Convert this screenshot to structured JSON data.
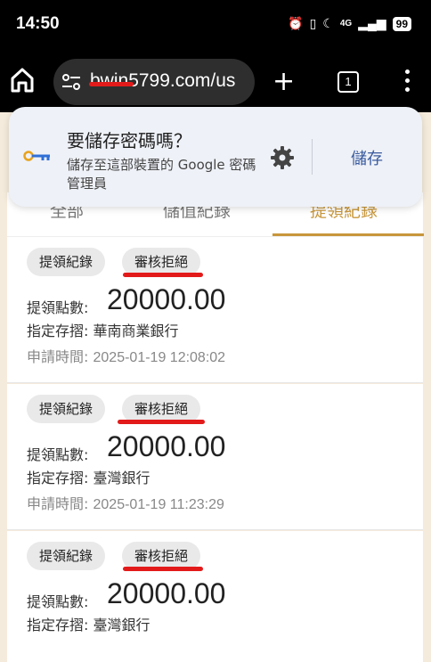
{
  "status_bar": {
    "time": "14:50",
    "network": "4G",
    "battery": "99"
  },
  "browser": {
    "url": "bwin5799.com/us",
    "tab_count": "1"
  },
  "save_password_dialog": {
    "title": "要儲存密碼嗎？",
    "subtitle": "儲存至這部裝置的 Google 密碼管理員",
    "save_label": "儲存"
  },
  "tabs": [
    {
      "label": "全部"
    },
    {
      "label": "儲值紀錄"
    },
    {
      "label": "提領紀錄",
      "active": true
    }
  ],
  "records": [
    {
      "type_label": "提領紀錄",
      "status_label": "審核拒絕",
      "amount_label": "提領點數:",
      "amount": "20000.00",
      "bank_label": "指定存摺:",
      "bank": "華南商業銀行",
      "time_label": "申請時間:",
      "time": "2025-01-19 12:08:02"
    },
    {
      "type_label": "提領紀錄",
      "status_label": "審核拒絕",
      "amount_label": "提領點數:",
      "amount": "20000.00",
      "bank_label": "指定存摺:",
      "bank": "臺灣銀行",
      "time_label": "申請時間:",
      "time": "2025-01-19 11:23:29"
    },
    {
      "type_label": "提領紀錄",
      "status_label": "審核拒絕",
      "amount_label": "提領點數:",
      "amount": "20000.00",
      "bank_label": "指定存摺:",
      "bank": "臺灣銀行"
    }
  ],
  "colors": {
    "accent": "#c8973b",
    "highlight_mark": "#e31a1a",
    "save_button": "#3a5b9e"
  }
}
